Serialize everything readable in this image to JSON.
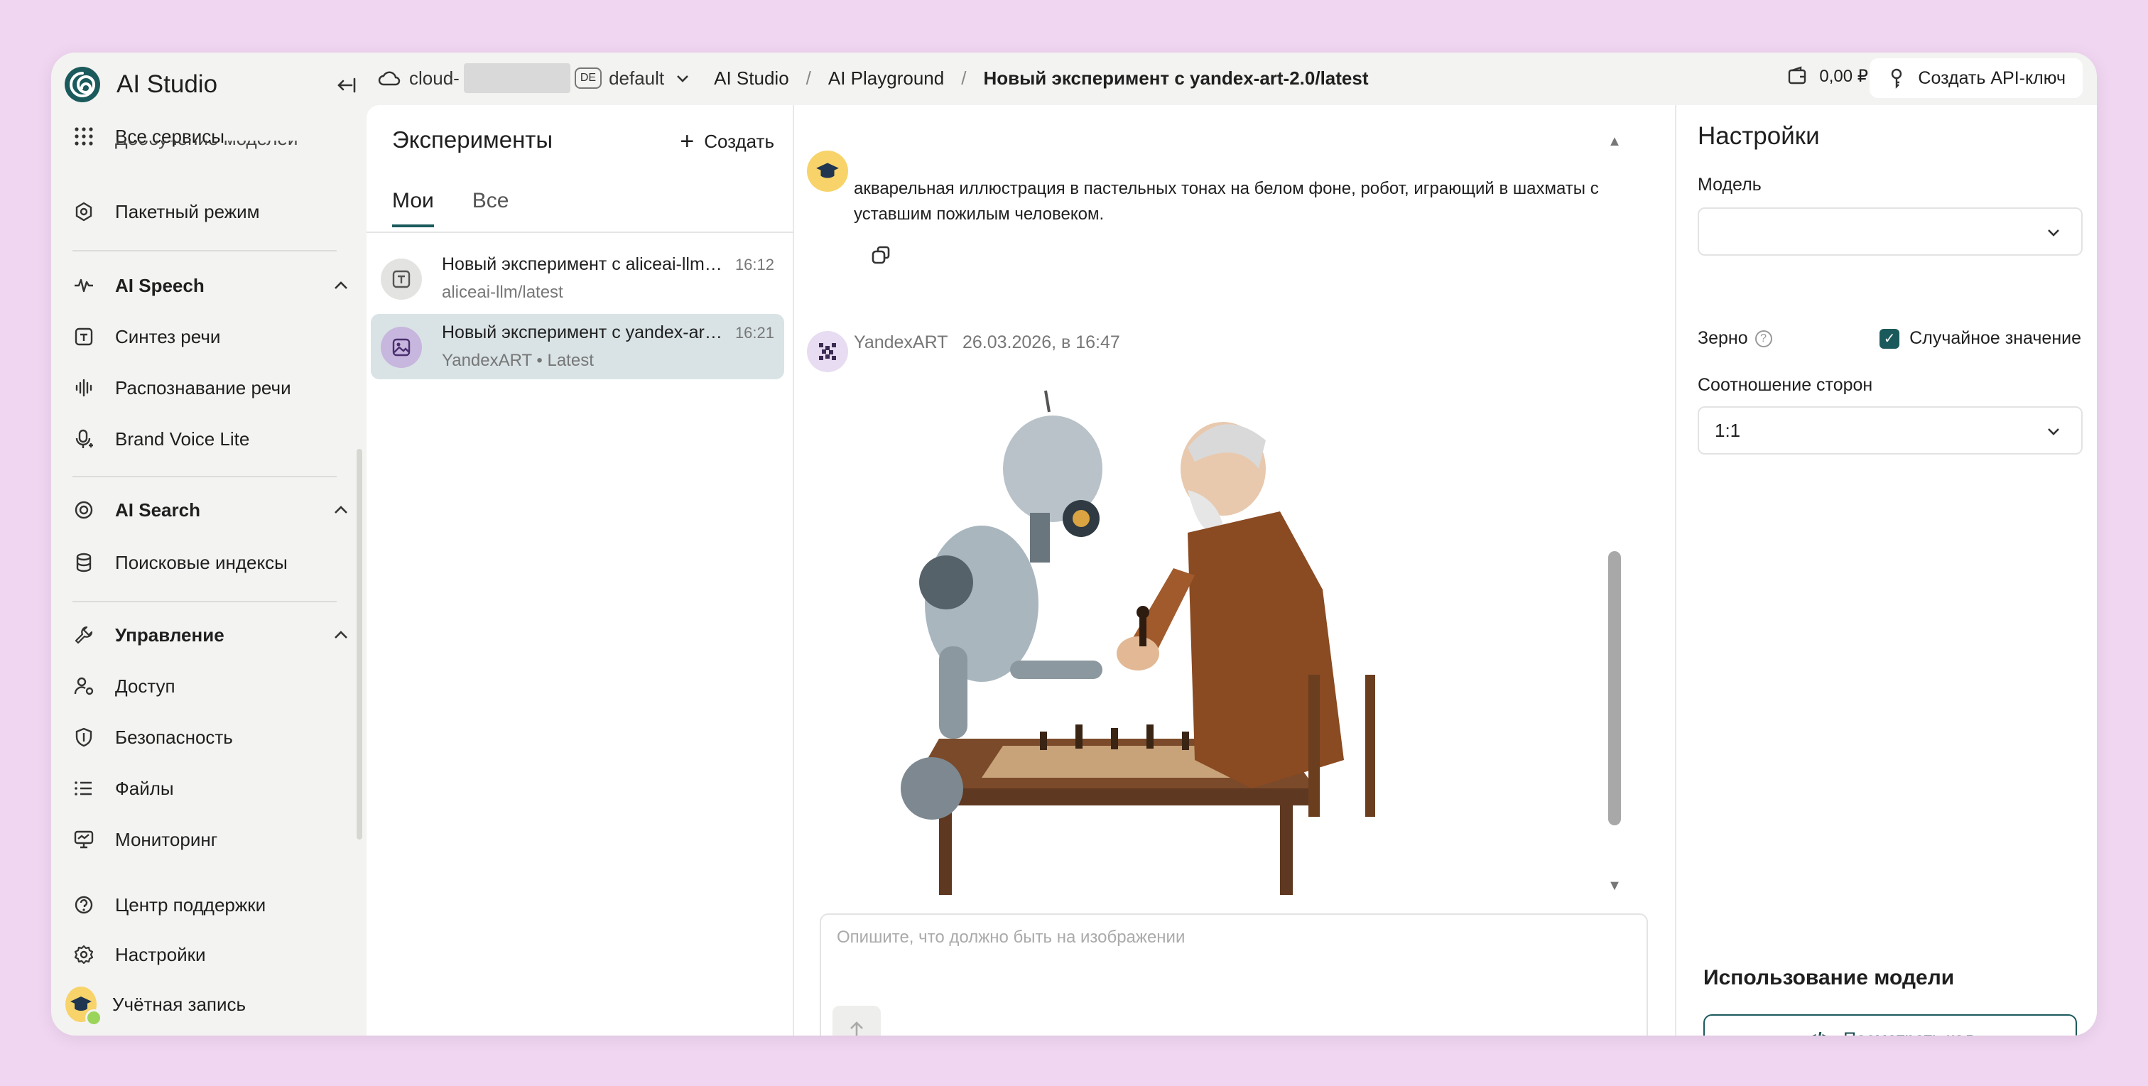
{
  "app": {
    "title": "AI Studio"
  },
  "sidebar": {
    "clipped_item": "Дообучение моделей",
    "items": [
      {
        "label": "Все сервисы"
      },
      {
        "label": "Пакетный режим"
      },
      {
        "label": "AI Speech"
      },
      {
        "label": "Синтез речи"
      },
      {
        "label": "Распознавание речи"
      },
      {
        "label": "Brand Voice Lite"
      },
      {
        "label": "AI Search"
      },
      {
        "label": "Поисковые индексы"
      },
      {
        "label": "Управление"
      },
      {
        "label": "Доступ"
      },
      {
        "label": "Безопасность"
      },
      {
        "label": "Файлы"
      },
      {
        "label": "Мониторинг"
      },
      {
        "label": "Центр поддержки"
      },
      {
        "label": "Настройки"
      },
      {
        "label": "Учётная запись"
      }
    ]
  },
  "topbar": {
    "cloud_prefix": "cloud-",
    "region_badge": "DE",
    "folder": "default",
    "breadcrumbs": [
      "AI Studio",
      "AI Playground",
      "Новый эксперимент с yandex-art-2.0/latest"
    ],
    "balance": "0,00 ₽",
    "api_button": "Создать API-ключ"
  },
  "experiments": {
    "title": "Эксперименты",
    "create_label": "Создать",
    "tabs": [
      "Мои",
      "Все"
    ],
    "items": [
      {
        "name": "Новый эксперимент с aliceai-llm/latest",
        "sub": "aliceai-llm/latest",
        "time": "16:12"
      },
      {
        "name": "Новый эксперимент с yandex-art-2.0/latest",
        "sub": "YandexART • Latest",
        "time": "16:21"
      }
    ]
  },
  "chat": {
    "user_message": "акварельная иллюстрация в пастельных тонах на белом фоне, робот, играющий в шахматы с уставшим пожилым человеком.",
    "bot_name": "YandexART",
    "bot_time": "26.03.2026, в 16:47",
    "input_placeholder": "Опишите, что должно быть на изображении"
  },
  "settings": {
    "title": "Настройки",
    "model_label": "Модель",
    "model_value": "",
    "seed_label": "Зерно",
    "random_label": "Случайное значение",
    "random_checked": true,
    "aspect_label": "Соотношение сторон",
    "aspect_value": "1:1",
    "usage_title": "Использование модели",
    "view_code_label": "Посмотреть код"
  },
  "colors": {
    "accent": "#1b5a5c",
    "background": "#f0d6f1",
    "selected_item": "#d9e3e5"
  }
}
